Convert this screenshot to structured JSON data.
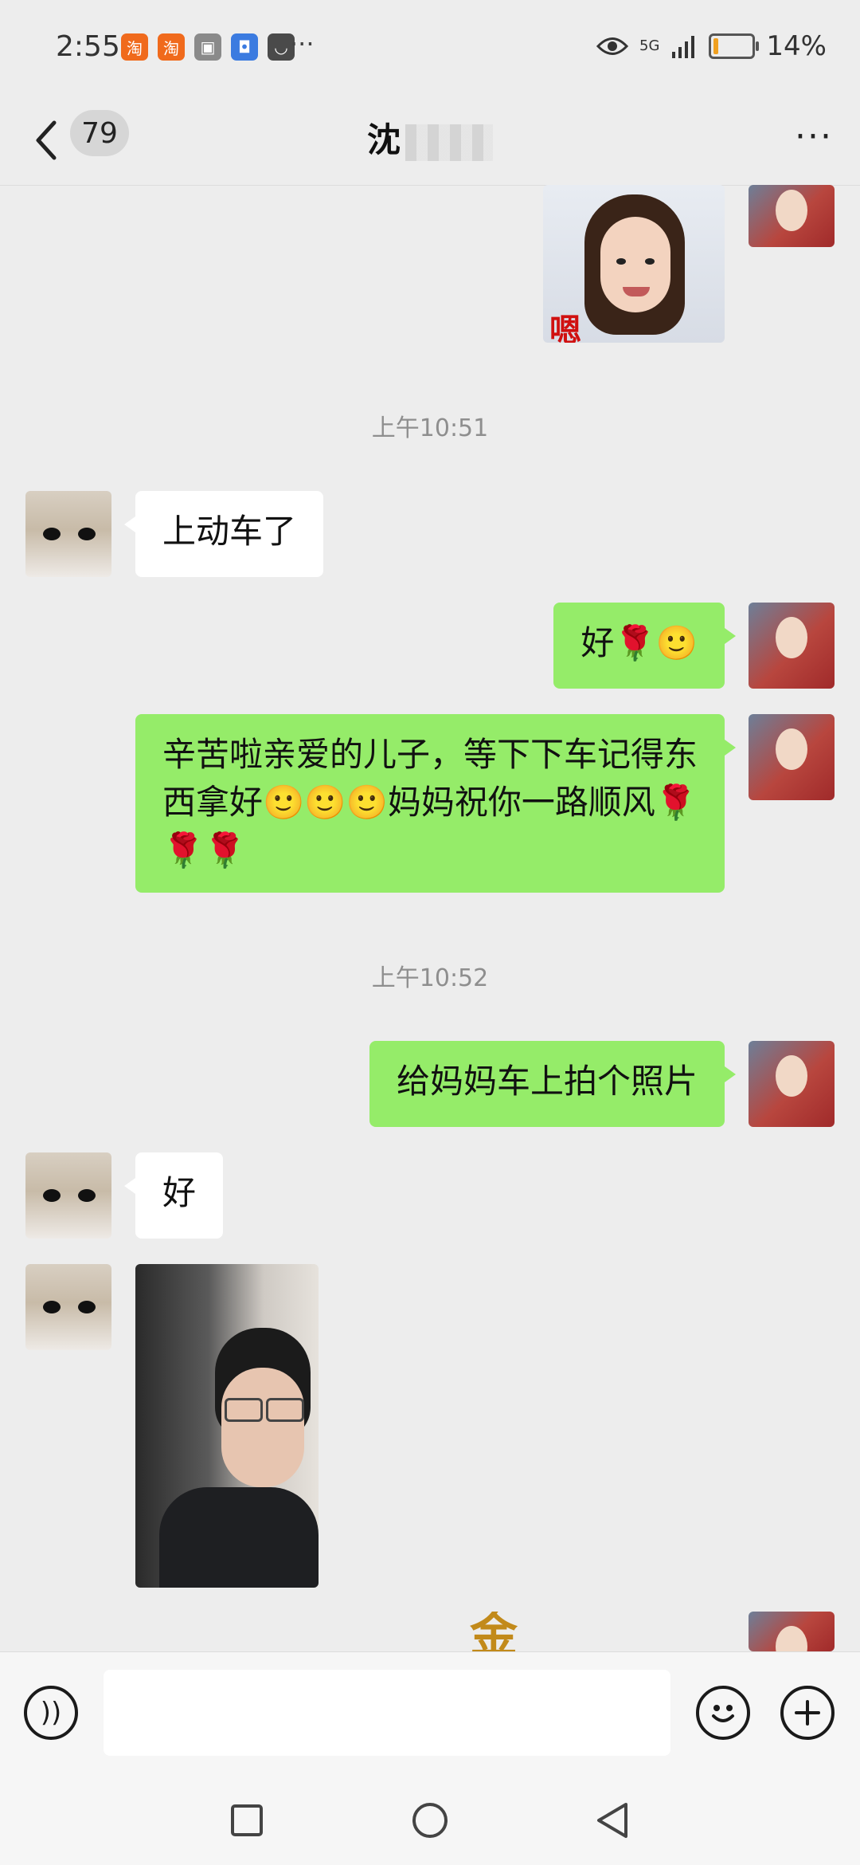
{
  "status_bar": {
    "time": "2:55",
    "notification_icons": [
      "taobao-icon",
      "taobao-icon",
      "gallery-icon",
      "security-icon",
      "shopping-bag-icon"
    ],
    "network": "5G",
    "battery_percent": "14%",
    "battery_level": 0.14
  },
  "header": {
    "unread_count": "79",
    "contact_name": "沈"
  },
  "messages": [
    {
      "type": "image",
      "side": "right",
      "caption": "嗯"
    },
    {
      "type": "timestamp",
      "text": "上午10:51"
    },
    {
      "type": "text",
      "side": "left",
      "text": "上动车了"
    },
    {
      "type": "text",
      "side": "right",
      "text": "好🌹🙂"
    },
    {
      "type": "text",
      "side": "right",
      "text": "辛苦啦亲爱的儿子，等下下车记得东西拿好🙂🙂🙂妈妈祝你一路顺风🌹🌹🌹"
    },
    {
      "type": "timestamp",
      "text": "上午10:52"
    },
    {
      "type": "text",
      "side": "right",
      "text": "给妈妈车上拍个照片"
    },
    {
      "type": "text",
      "side": "left",
      "text": "好"
    },
    {
      "type": "image",
      "side": "left"
    },
    {
      "type": "image",
      "side": "right",
      "caption": "金"
    }
  ],
  "colors": {
    "background": "#ededed",
    "bubble_self": "#95ec69",
    "bubble_other": "#ffffff",
    "timestamp": "#8e8e8e"
  },
  "input_bar": {
    "left_icon": "voice-icon",
    "emoji_icon": "emoji-icon",
    "add_icon": "plus-icon"
  },
  "nav_bar": [
    "recent-apps-icon",
    "home-icon",
    "back-icon"
  ]
}
